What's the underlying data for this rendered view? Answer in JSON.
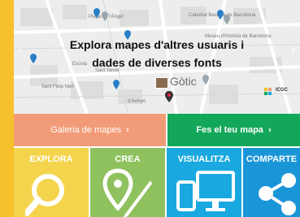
{
  "map": {
    "title_line1": "Explora mapes d'altres usuaris i",
    "title_line2": "dades de diverses fonts",
    "district": "Gòtic",
    "logo_text": "ICGC",
    "streets": [
      "Catedral Basílica de Barcelona",
      "Museu d'Història de Barcelona",
      "Escola",
      "Sant Felip Neri",
      "Plaça de l'Àngel",
      "Sant Sever",
      "d'Avinyó"
    ]
  },
  "buttons": {
    "gallery": "Galeria de mapes",
    "make_map": "Fes el teu mapa"
  },
  "tiles": {
    "explore": "EXPLORA",
    "create": "CREA",
    "visualize": "VISUALITZA",
    "share": "COMPARTE"
  },
  "colors": {
    "brand_yellow": "#f6c12b",
    "salmon": "#f29b78",
    "green": "#13a75a",
    "tile_yellow": "#f3d44c",
    "tile_green": "#8fc15e",
    "tile_blue": "#1aa8e0"
  }
}
